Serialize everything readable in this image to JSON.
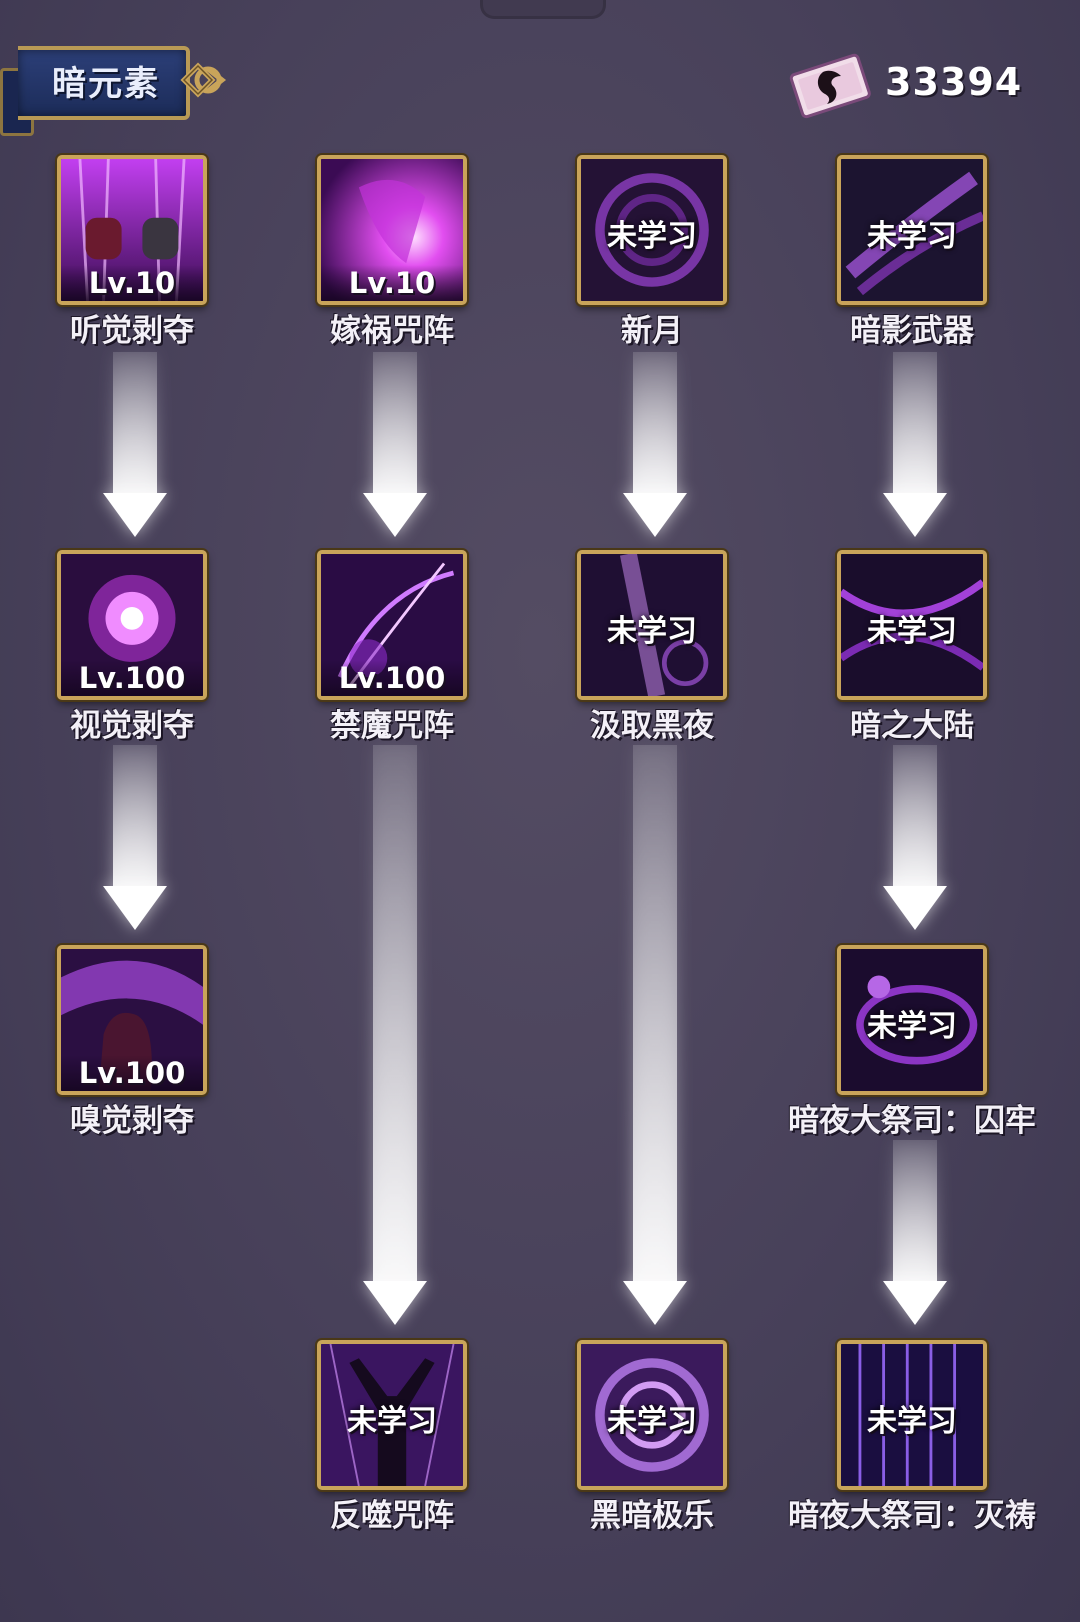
{
  "header": {
    "title": "暗元素",
    "currency": "33394"
  },
  "skills": [
    {
      "name": "听觉剥夺",
      "level": "Lv.10",
      "status": ""
    },
    {
      "name": "嫁祸咒阵",
      "level": "Lv.10",
      "status": ""
    },
    {
      "name": "新月",
      "level": "",
      "status": "未学习"
    },
    {
      "name": "暗影武器",
      "level": "",
      "status": "未学习"
    },
    {
      "name": "视觉剥夺",
      "level": "Lv.100",
      "status": ""
    },
    {
      "name": "禁魔咒阵",
      "level": "Lv.100",
      "status": ""
    },
    {
      "name": "汲取黑夜",
      "level": "",
      "status": "未学习"
    },
    {
      "name": "暗之大陆",
      "level": "",
      "status": "未学习"
    },
    {
      "name": "嗅觉剥夺",
      "level": "Lv.100",
      "status": ""
    },
    {
      "name": "暗夜大祭司：囚牢",
      "level": "",
      "status": "未学习"
    },
    {
      "name": "反噬咒阵",
      "level": "",
      "status": "未学习"
    },
    {
      "name": "黑暗极乐",
      "level": "",
      "status": "未学习"
    },
    {
      "name": "暗夜大祭司：灭祷",
      "level": "",
      "status": "未学习"
    }
  ],
  "colors": {
    "frame_gold": "#c9a45a",
    "banner_blue": "#2c3f78",
    "arcane_purple": "#9b2fd6"
  }
}
